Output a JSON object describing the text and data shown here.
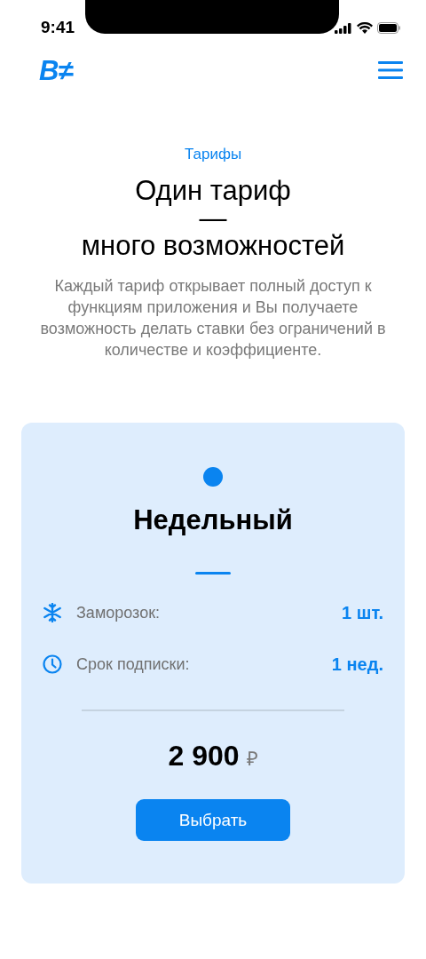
{
  "status_bar": {
    "time": "9:41"
  },
  "header": {
    "logo": "B≠"
  },
  "intro": {
    "eyebrow": "Тарифы",
    "title_top": "Один тариф",
    "dash": "—",
    "title_bottom": "много возможностей",
    "text": "Каждый тариф открывает полный доступ к функциям приложения и Вы получаете возможность делать ставки без ограничений в количестве и коэффициенте."
  },
  "plan": {
    "name": "Недельный",
    "features": [
      {
        "kind": "freeze",
        "label": "Заморозок:",
        "value": "1 шт."
      },
      {
        "kind": "duration",
        "label": "Срок подписки:",
        "value": "1 нед."
      }
    ],
    "price": "2 900",
    "currency": "₽",
    "button": "Выбрать"
  }
}
